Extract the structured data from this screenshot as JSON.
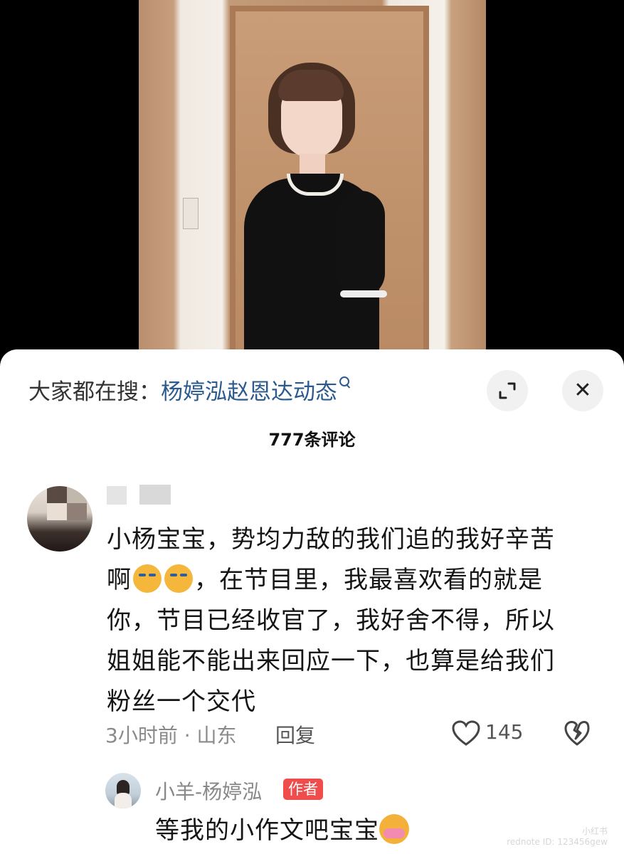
{
  "search": {
    "prefix": "大家都在搜：",
    "term": "杨婷泓赵恩达动态"
  },
  "comments": {
    "count_label": "777条评论",
    "main": {
      "text_line1": "小杨宝宝，势均力敌的我们追的我好辛苦",
      "text_line2_start": "啊",
      "text_line2_end": "，在节目里，我最喜欢看的就是",
      "text_line3": "你，节目已经收官了，我好舍不得，所以",
      "text_line4": "姐姐能不能出来回应一下，也算是给我们",
      "text_line5": "粉丝一个交代",
      "time_location": "3小时前 · 山东",
      "reply_label": "回复",
      "likes": "145"
    },
    "author_reply": {
      "username": "小羊-杨婷泓",
      "badge": "作者",
      "text": "等我的小作文吧宝宝"
    }
  },
  "watermark": {
    "line1": "小红书",
    "line2": "rednote ID: 123456gew"
  },
  "icons": {
    "expand": "expand-icon",
    "close": "close-icon",
    "like": "heart-outline-icon",
    "dislike": "broken-heart-icon",
    "emoji_cry": "crying-face-emoji",
    "emoji_hug": "hugging-face-emoji"
  },
  "colors": {
    "search_term": "#2b5b8e",
    "badge_bg": "#ef4c4c",
    "meta_text": "#8a8a8a"
  }
}
